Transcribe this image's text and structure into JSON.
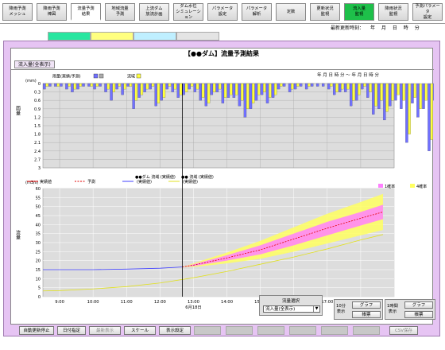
{
  "tabs": [
    {
      "label": "降雨予測\nメッシュ",
      "state": "normal"
    },
    {
      "label": "降雨予測\n棒図",
      "state": "normal"
    },
    {
      "label": "流量予測\n結果",
      "state": "active"
    },
    {
      "label": "地域流量\n予測",
      "state": "normal"
    },
    {
      "label": "上流ダム\n放流計画",
      "state": "normal"
    },
    {
      "label": "ダム水位\nシミュレーション",
      "state": "normal"
    },
    {
      "label": "パラメータ\n設定",
      "state": "normal"
    },
    {
      "label": "パラメータ\n解析",
      "state": "normal"
    },
    {
      "label": "定数",
      "state": "normal"
    },
    {
      "label": "更新状況\n監視",
      "state": "normal"
    },
    {
      "label": "流入量\n監視",
      "state": "green"
    },
    {
      "label": "降雨状況\n監視",
      "state": "normal"
    },
    {
      "label": "予測パラメータ\n設定",
      "state": "normal"
    }
  ],
  "last_update": {
    "label": "最新更新時刻：",
    "parts": [
      "年",
      "月",
      "日",
      "時",
      "分"
    ]
  },
  "color_tabs": [
    {
      "color": "#28e6a0"
    },
    {
      "color": "#ffff80"
    },
    {
      "color": "#bfefff"
    },
    {
      "color": "#e4e4e4"
    }
  ],
  "panel": {
    "title": "【●●ダム】流量予測結果",
    "flow_button": "流入量(全表示)",
    "time_range_header": "年 月 日 時 分 ～ 年 月 日 時 分"
  },
  "chart_data": [
    {
      "type": "bar",
      "name": "rainfall",
      "legend": [
        {
          "name": "雨量(実績/予測)",
          "color": "#7070ff"
        },
        {
          "name": "流域",
          "color": "#ffff40"
        }
      ],
      "ylabel": "雨量",
      "yunit": "(mm)",
      "yticks": [
        0.0,
        0.3,
        0.6,
        0.9,
        1.2,
        1.5,
        1.8,
        2.1,
        2.4,
        2.7,
        3.0
      ],
      "ylim": [
        0,
        3.0
      ],
      "inverted": true,
      "x_start": "8:30",
      "x_end": "19:00",
      "interval_minutes": 10,
      "series": [
        {
          "name": "実績",
          "color": "#7070ff",
          "values": [
            0.2,
            0.1,
            0.1,
            0.1,
            0.2,
            0.3,
            0.2,
            0.1,
            0.1,
            0.2,
            0.1,
            0.3,
            0.6,
            0.2,
            0.4,
            0.1,
            0.9,
            0.5,
            0.3,
            0.2,
            0.8,
            0.6,
            0.2,
            0.3,
            0.5,
            0.4,
            0.2,
            0.3,
            0.6,
            0.8,
            0.4,
            0.3,
            0.7,
            0.5,
            0.5,
            0.8,
            1.2,
            0.9,
            0.6,
            0.4,
            0.7,
            0.5,
            0.2,
            0.1,
            0.3,
            0.2,
            0.1,
            0.2,
            0.1,
            0.1,
            0.1,
            0.2,
            0.4,
            0.3,
            0.3,
            0.8,
            0.6,
            0.2,
            0.5,
            1.1,
            0.9,
            1.3,
            0.8,
            0.6,
            0.9,
            2.1,
            0.7,
            1.2,
            0.9,
            2.4,
            0.6,
            2.0,
            1.9,
            0.8,
            1.4,
            2.6,
            0.4,
            1.5,
            0.9,
            2.8,
            1.2,
            1.8,
            1.1,
            0.5,
            1.2,
            2.2,
            0.6,
            1.8,
            2.5,
            0.8,
            1.5,
            0.6,
            1.0,
            1.5,
            2.0,
            0.5,
            2.0,
            0.7,
            2.4,
            2.5
          ]
        },
        {
          "name": "流域",
          "color": "#ffff40",
          "values": [
            0.1,
            0.0,
            0.1,
            0.0,
            0.1,
            0.2,
            0.1,
            0.0,
            0.1,
            0.1,
            0.0,
            0.2,
            0.3,
            0.1,
            0.2,
            0.1,
            0.6,
            0.4,
            0.2,
            0.1,
            0.7,
            0.5,
            0.1,
            0.2,
            0.4,
            0.3,
            0.1,
            0.2,
            0.5,
            0.7,
            0.3,
            0.2,
            0.5,
            0.4,
            0.4,
            0.6,
            0.9,
            0.7,
            0.4,
            0.3,
            0.5,
            0.4,
            0.1,
            0.0,
            0.2,
            0.1,
            0.0,
            0.1,
            0.0,
            0.0,
            0.0,
            0.1,
            0.3,
            0.2,
            0.2,
            0.6,
            0.4,
            0.1,
            0.3,
            0.8,
            0.6,
            1.0,
            0.6,
            0.4,
            0.6,
            1.8,
            0.5,
            0.9,
            0.6,
            2.0,
            0.4,
            1.6,
            1.5,
            0.6,
            1.1,
            2.3,
            0.3,
            1.2,
            0.6,
            2.4,
            0.9,
            1.4,
            0.8,
            0.3,
            0.9,
            1.8,
            0.4,
            1.5,
            2.1,
            0.6,
            1.2,
            0.4,
            0.7,
            1.2,
            1.7,
            0.3,
            1.7,
            0.5,
            2.1,
            2.2
          ]
        }
      ]
    },
    {
      "type": "line",
      "name": "discharge",
      "ylabel": "流量",
      "yunit": "(m3/s)",
      "ylim": [
        0,
        60
      ],
      "yticks": [
        0,
        5,
        10,
        15,
        20,
        25,
        30,
        35,
        40,
        45,
        50,
        55,
        60
      ],
      "xticks": [
        "9:00",
        "10:00",
        "11:00",
        "12:00",
        "13:00",
        "14:00",
        "15:00",
        "16:00",
        "17:00",
        "18:00",
        "19:00"
      ],
      "date_label": "6月18日",
      "now": "12:40",
      "legend": [
        {
          "name": "実績値",
          "color": "#e00000",
          "style": "solid"
        },
        {
          "name": "予測",
          "color": "#e00000",
          "style": "dashed"
        },
        {
          "name": "●●ダム 流域\n(実績値)",
          "color": "#4040ff",
          "style": "solid"
        },
        {
          "name": "●● 流域\n(実績値)",
          "color": "#e0e020",
          "style": "solid"
        }
      ],
      "band_legend": [
        {
          "name": "1確率",
          "color": "#ff80ff"
        },
        {
          "name": "4確率",
          "color": "#ffff60"
        }
      ],
      "series": [
        {
          "name": "●●ダム 流域(実績値)",
          "color": "#4040ff",
          "x": [
            "8:30",
            "9:00",
            "10:00",
            "11:00",
            "12:00",
            "12:40"
          ],
          "y": [
            15,
            15,
            15,
            15.3,
            15.8,
            16.5
          ]
        },
        {
          "name": "●● 流域(実績値)",
          "color": "#e0e020",
          "x": [
            "8:30",
            "9:00",
            "10:00",
            "11:00",
            "12:00",
            "13:00",
            "14:00",
            "15:00",
            "16:00",
            "17:00",
            "18:00",
            "18:40"
          ],
          "y": [
            3.2,
            3.4,
            4.3,
            5.6,
            7.6,
            10.5,
            14,
            18,
            22,
            26.5,
            31.5,
            34.5
          ]
        },
        {
          "name": "予測",
          "color": "#e00000",
          "x": [
            "12:40",
            "13:00",
            "14:00",
            "15:00",
            "16:00",
            "17:00",
            "18:00",
            "18:40"
          ],
          "y": [
            16.5,
            17.5,
            21.5,
            26,
            32,
            38,
            43.5,
            47
          ]
        },
        {
          "name": "1確率 upper",
          "x": [
            "12:40",
            "13:00",
            "14:00",
            "15:00",
            "16:00",
            "17:00",
            "18:00",
            "18:40"
          ],
          "y": [
            16.5,
            18,
            23,
            28.5,
            35,
            41.5,
            47,
            51
          ]
        },
        {
          "name": "1確率 lower",
          "x": [
            "12:40",
            "13:00",
            "14:00",
            "15:00",
            "16:00",
            "17:00",
            "18:00",
            "18:40"
          ],
          "y": [
            16.5,
            17,
            20,
            23.5,
            28.5,
            34,
            39.5,
            43
          ]
        },
        {
          "name": "4確率 upper",
          "x": [
            "12:40",
            "13:00",
            "14:00",
            "15:00",
            "16:00",
            "17:00",
            "18:00",
            "18:40"
          ],
          "y": [
            16.5,
            18.5,
            24.5,
            31,
            38.5,
            46,
            52.5,
            57
          ]
        },
        {
          "name": "4確率 lower",
          "x": [
            "12:40",
            "13:00",
            "14:00",
            "15:00",
            "16:00",
            "17:00",
            "18:00",
            "18:40"
          ],
          "y": [
            16.5,
            16.5,
            18.5,
            21,
            25,
            29.5,
            34,
            37
          ]
        }
      ]
    }
  ],
  "controls": {
    "select_label": "流量選択",
    "select_value": "流入量(全表示)",
    "mode10_label": "10分\n表示",
    "mode60_label": "1時間\n表示",
    "graph": "グラフ",
    "table": "帳票"
  },
  "bottom_buttons": [
    {
      "label": "自動更新停止",
      "state": "normal"
    },
    {
      "label": "日付指定",
      "state": "normal"
    },
    {
      "label": "最新表示",
      "state": "disabled"
    },
    {
      "label": "スケール",
      "state": "normal"
    },
    {
      "label": "表示設定",
      "state": "normal"
    },
    {
      "label": "",
      "state": "blank"
    },
    {
      "label": "",
      "state": "blank"
    },
    {
      "label": "",
      "state": "blank"
    },
    {
      "label": "",
      "state": "blank"
    },
    {
      "label": "",
      "state": "blank"
    },
    {
      "label": "",
      "state": "blank"
    },
    {
      "label": "CSV保存",
      "state": "disabled"
    }
  ]
}
